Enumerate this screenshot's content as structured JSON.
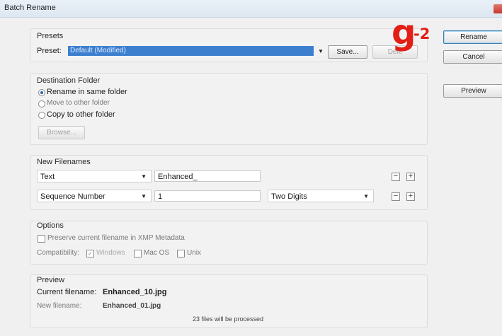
{
  "window": {
    "title": "Batch Rename"
  },
  "presets": {
    "group_label": "Presets",
    "preset_label": "Preset:",
    "preset_value": "Default (Modified)",
    "save_label": "Save...",
    "delete_label": "Dele"
  },
  "annotation": {
    "letter": "g",
    "suffix": "-2"
  },
  "side_buttons": {
    "rename": "Rename",
    "cancel": "Cancel",
    "preview": "Preview"
  },
  "destination": {
    "group_label": "Destination Folder",
    "options": [
      {
        "label": "Rename in same folder",
        "selected": true
      },
      {
        "label": "Move to other folder",
        "selected": false
      },
      {
        "label": "Copy to other folder",
        "selected": false
      }
    ],
    "browse_label": "Browse..."
  },
  "new_filenames": {
    "group_label": "New Filenames",
    "rows": [
      {
        "type": "Text",
        "value": "Enhanced_",
        "extra": ""
      },
      {
        "type": "Sequence Number",
        "value": "1",
        "extra": "Two Digits"
      }
    ]
  },
  "options": {
    "group_label": "Options",
    "preserve_label": "Preserve current filename in XMP Metadata",
    "compat_label": "Compatibility:",
    "windows_label": "Windows",
    "windows_checked": true,
    "macos_label": "Mac OS",
    "macos_checked": false,
    "unix_label": "Unix",
    "unix_checked": false
  },
  "preview": {
    "group_label": "Preview",
    "current_label": "Current filename:",
    "current_value": "Enhanced_10.jpg",
    "new_label": "New filename:",
    "new_value": "Enhanced_01.jpg",
    "files_note": "23 files will be processed"
  }
}
